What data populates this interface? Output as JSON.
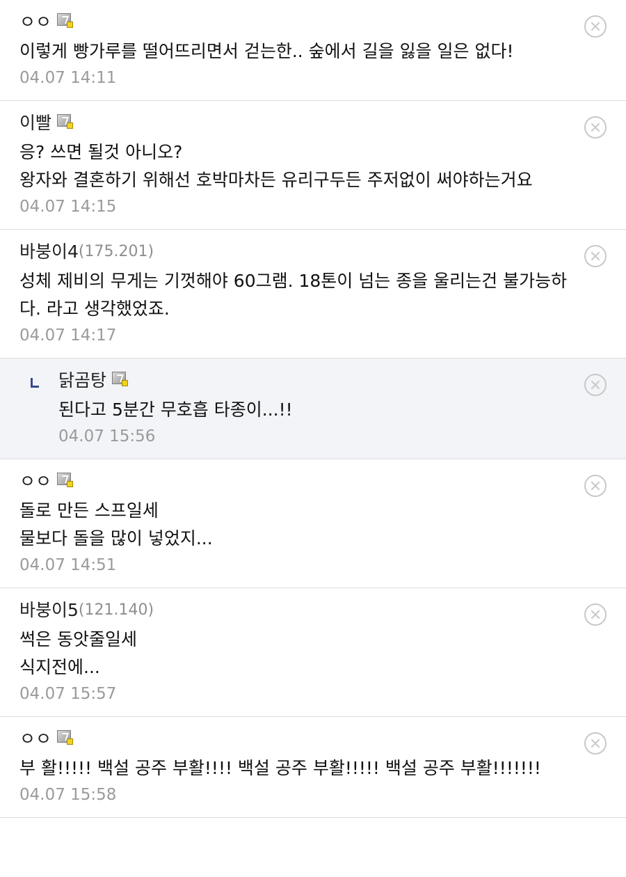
{
  "comments": [
    {
      "nick": "ㅇㅇ",
      "ip": "",
      "icon": "fixed-member-icon",
      "lines": [
        "이렇게 빵가루를 떨어뜨리면서 걷는한.. 숲에서 길을 잃을 일은 없다!"
      ],
      "date": "04.07 14:11"
    },
    {
      "nick": "이빨",
      "ip": "",
      "icon": "fixed-member-icon",
      "lines": [
        "응? 쓰면 될것 아니오?",
        "왕자와 결혼하기 위해선 호박마차든 유리구두든 주저없이 써야하는거요"
      ],
      "date": "04.07 14:15"
    },
    {
      "nick": "바붕이4",
      "ip": "(175.201)",
      "icon": "",
      "lines": [
        "성체 제비의 무게는 기껏해야 60그램. 18톤이 넘는 종을 울리는건 불가능하",
        "다. 라고 생각했었죠."
      ],
      "date": "04.07 14:17"
    },
    {
      "nick": "닭곰탕",
      "ip": "",
      "icon": "semi-fixed-member-icon",
      "reply": true,
      "lines": [
        "된다고 5분간 무호흡 타종이...!!"
      ],
      "date": "04.07 15:56"
    },
    {
      "nick": "ㅇㅇ",
      "ip": "",
      "icon": "fixed-member-icon",
      "lines": [
        "돌로 만든 스프일세",
        "물보다 돌을 많이 넣었지..."
      ],
      "date": "04.07 14:51"
    },
    {
      "nick": "바붕이5",
      "ip": "(121.140)",
      "icon": "",
      "lines": [
        "썩은 동앗줄일세",
        "식지전에..."
      ],
      "date": "04.07 15:57"
    },
    {
      "nick": "ㅇㅇ",
      "ip": "",
      "icon": "fixed-member-icon",
      "lines": [
        "부 활!!!!! 백설 공주 부활!!!! 백설 공주 부활!!!!! 백설 공주 부활!!!!!!!"
      ],
      "date": "04.07 15:58"
    }
  ],
  "colors": {
    "reply_background": "#f3f4f7",
    "reply_marker": "#3a4a8c",
    "date_text": "#9a9a9a",
    "ip_text": "#8e8e8e",
    "delete_icon": "#c8c8c8"
  }
}
